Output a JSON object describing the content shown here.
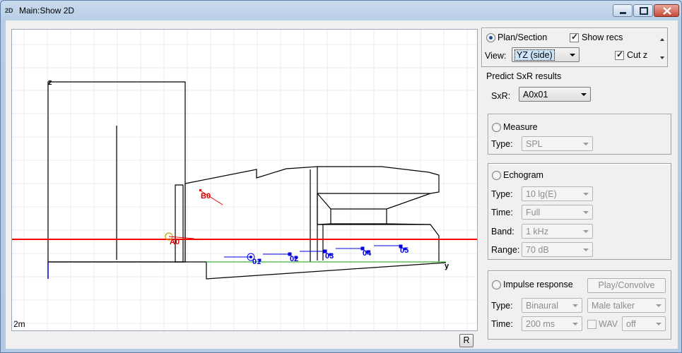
{
  "window": {
    "icon_text": "2D",
    "title": "Main:Show 2D"
  },
  "canvas": {
    "scale_label": "2m",
    "axis_z_label": "z",
    "axis_y_label": "y",
    "sources": [
      "A0",
      "B0"
    ],
    "receivers": [
      "01",
      "02",
      "03",
      "04",
      "05"
    ],
    "colors": {
      "cut_line": "#ff0000",
      "floor_line": "#3cb43c",
      "axis": "#0000c8",
      "receiver": "#0000e0",
      "source": "#e00000"
    }
  },
  "r_button": "R",
  "view_panel": {
    "plan_section_label": "Plan/Section",
    "plan_section_checked": true,
    "show_recs_label": "Show recs",
    "show_recs_checked": true,
    "view_label": "View:",
    "view_value": "YZ (side)",
    "cut_z_label": "Cut z",
    "cut_z_checked": true
  },
  "predict": {
    "title": "Predict SxR results",
    "sxr_label": "SxR:",
    "sxr_value": "A0x01"
  },
  "measure": {
    "label": "Measure",
    "type_label": "Type:",
    "type_value": "SPL"
  },
  "echogram": {
    "label": "Echogram",
    "type_label": "Type:",
    "type_value": "10 lg(E)",
    "time_label": "Time:",
    "time_value": "Full",
    "band_label": "Band:",
    "band_value": "1 kHz",
    "range_label": "Range:",
    "range_value": "70 dB"
  },
  "impulse": {
    "label": "Impulse response",
    "play_button": "Play/Convolve",
    "type_label": "Type:",
    "type_value": "Binaural",
    "talker_value": "Male talker",
    "time_label": "Time:",
    "time_value": "200 ms",
    "wav_label": "WAV",
    "wav_value": "off"
  }
}
